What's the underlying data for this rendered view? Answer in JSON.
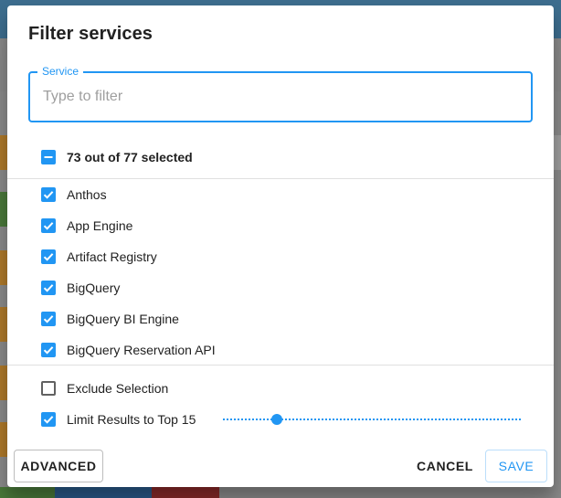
{
  "dialog": {
    "title": "Filter services",
    "search": {
      "label": "Service",
      "placeholder": "Type to filter",
      "value": ""
    },
    "summary": {
      "label": "73 out of 77 selected",
      "state": "indeterminate"
    },
    "services": [
      {
        "label": "Anthos",
        "checked": true
      },
      {
        "label": "App Engine",
        "checked": true
      },
      {
        "label": "Artifact Registry",
        "checked": true
      },
      {
        "label": "BigQuery",
        "checked": true
      },
      {
        "label": "BigQuery BI Engine",
        "checked": true
      },
      {
        "label": "BigQuery Reservation API",
        "checked": true
      }
    ],
    "options": {
      "exclude": {
        "label": "Exclude Selection",
        "checked": false
      },
      "limit": {
        "label": "Limit Results to Top 15",
        "checked": true,
        "slider_fraction": 0.18
      }
    },
    "buttons": {
      "advanced": "ADVANCED",
      "cancel": "CANCEL",
      "save": "SAVE"
    }
  },
  "colors": {
    "accent": "#2196f3",
    "text": "#212121",
    "divider": "#e0e0e0"
  }
}
